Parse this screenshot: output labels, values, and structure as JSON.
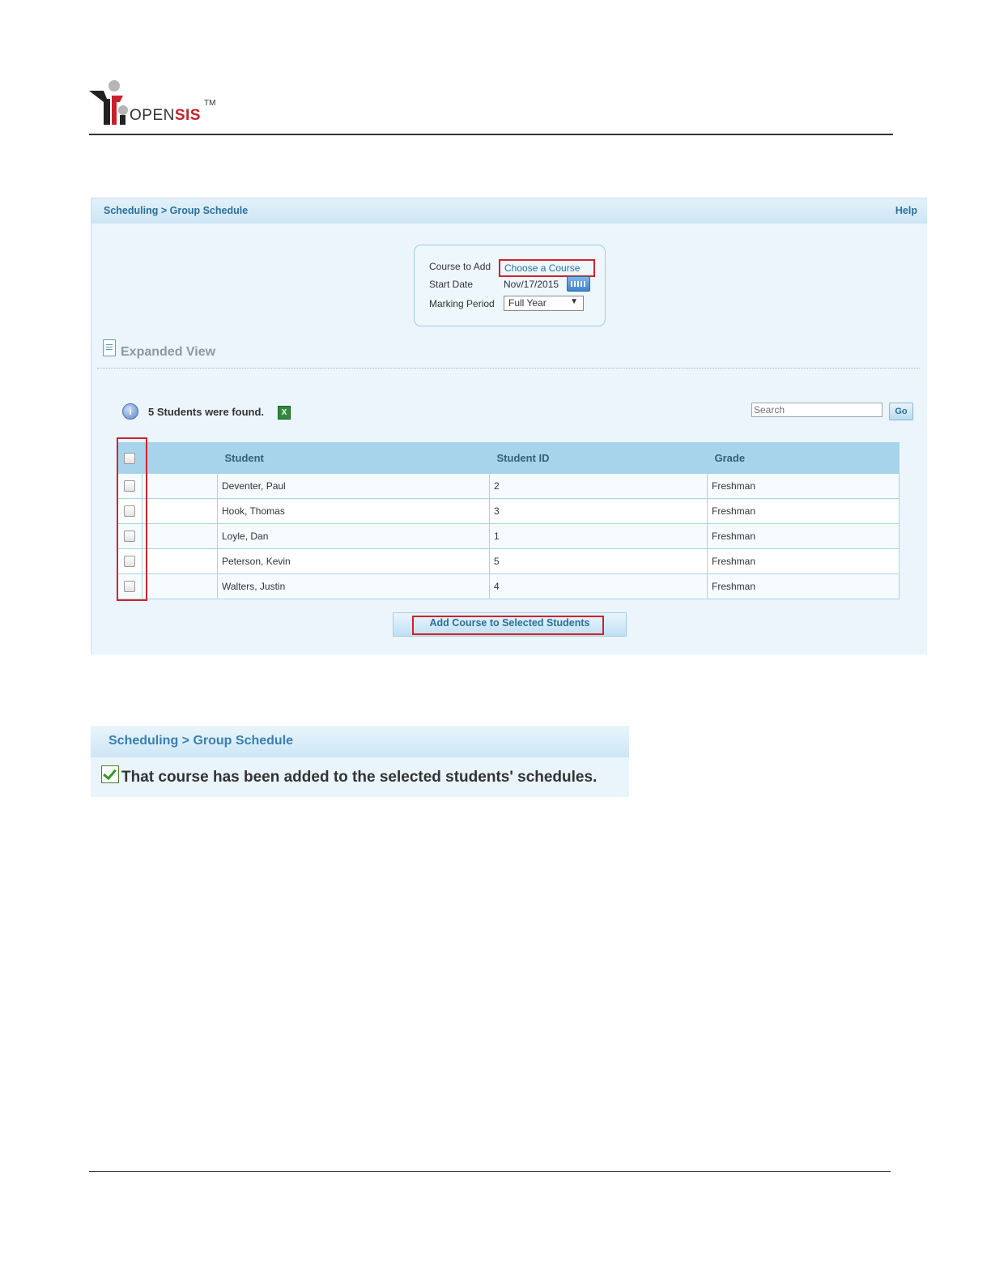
{
  "logo": {
    "text_open": "OPEN",
    "text_sis": "SIS",
    "tm": "TM"
  },
  "panel": {
    "breadcrumb": "Scheduling > Group Schedule",
    "help": "Help",
    "form": {
      "course_label": "Course to Add",
      "course_link": "Choose a Course",
      "start_label": "Start Date",
      "start_value": "Nov/17/2015",
      "mp_label": "Marking Period",
      "mp_value": "Full Year"
    },
    "expanded_view": "Expanded View",
    "found": "5 Students were found.",
    "search_placeholder": "Search",
    "go": "Go",
    "table": {
      "headers": [
        "Student",
        "Student ID",
        "Grade"
      ],
      "rows": [
        {
          "student": "Deventer, Paul",
          "id": "2",
          "grade": "Freshman"
        },
        {
          "student": "Hook, Thomas",
          "id": "3",
          "grade": "Freshman"
        },
        {
          "student": "Loyle, Dan",
          "id": "1",
          "grade": "Freshman"
        },
        {
          "student": "Peterson, Kevin",
          "id": "5",
          "grade": "Freshman"
        },
        {
          "student": "Walters, Justin",
          "id": "4",
          "grade": "Freshman"
        }
      ]
    },
    "add_button": "Add Course to Selected Students"
  },
  "panel2": {
    "breadcrumb": "Scheduling > Group Schedule",
    "message": "That course has been added to the selected students' schedules."
  },
  "colors": {
    "accent": "#2a6f9e",
    "highlight": "#d1222c",
    "header_bg": "#a7d4ea"
  },
  "icons": [
    "calendar-icon",
    "document-icon",
    "info-icon",
    "excel-icon",
    "checkbox-icon",
    "check-icon"
  ]
}
